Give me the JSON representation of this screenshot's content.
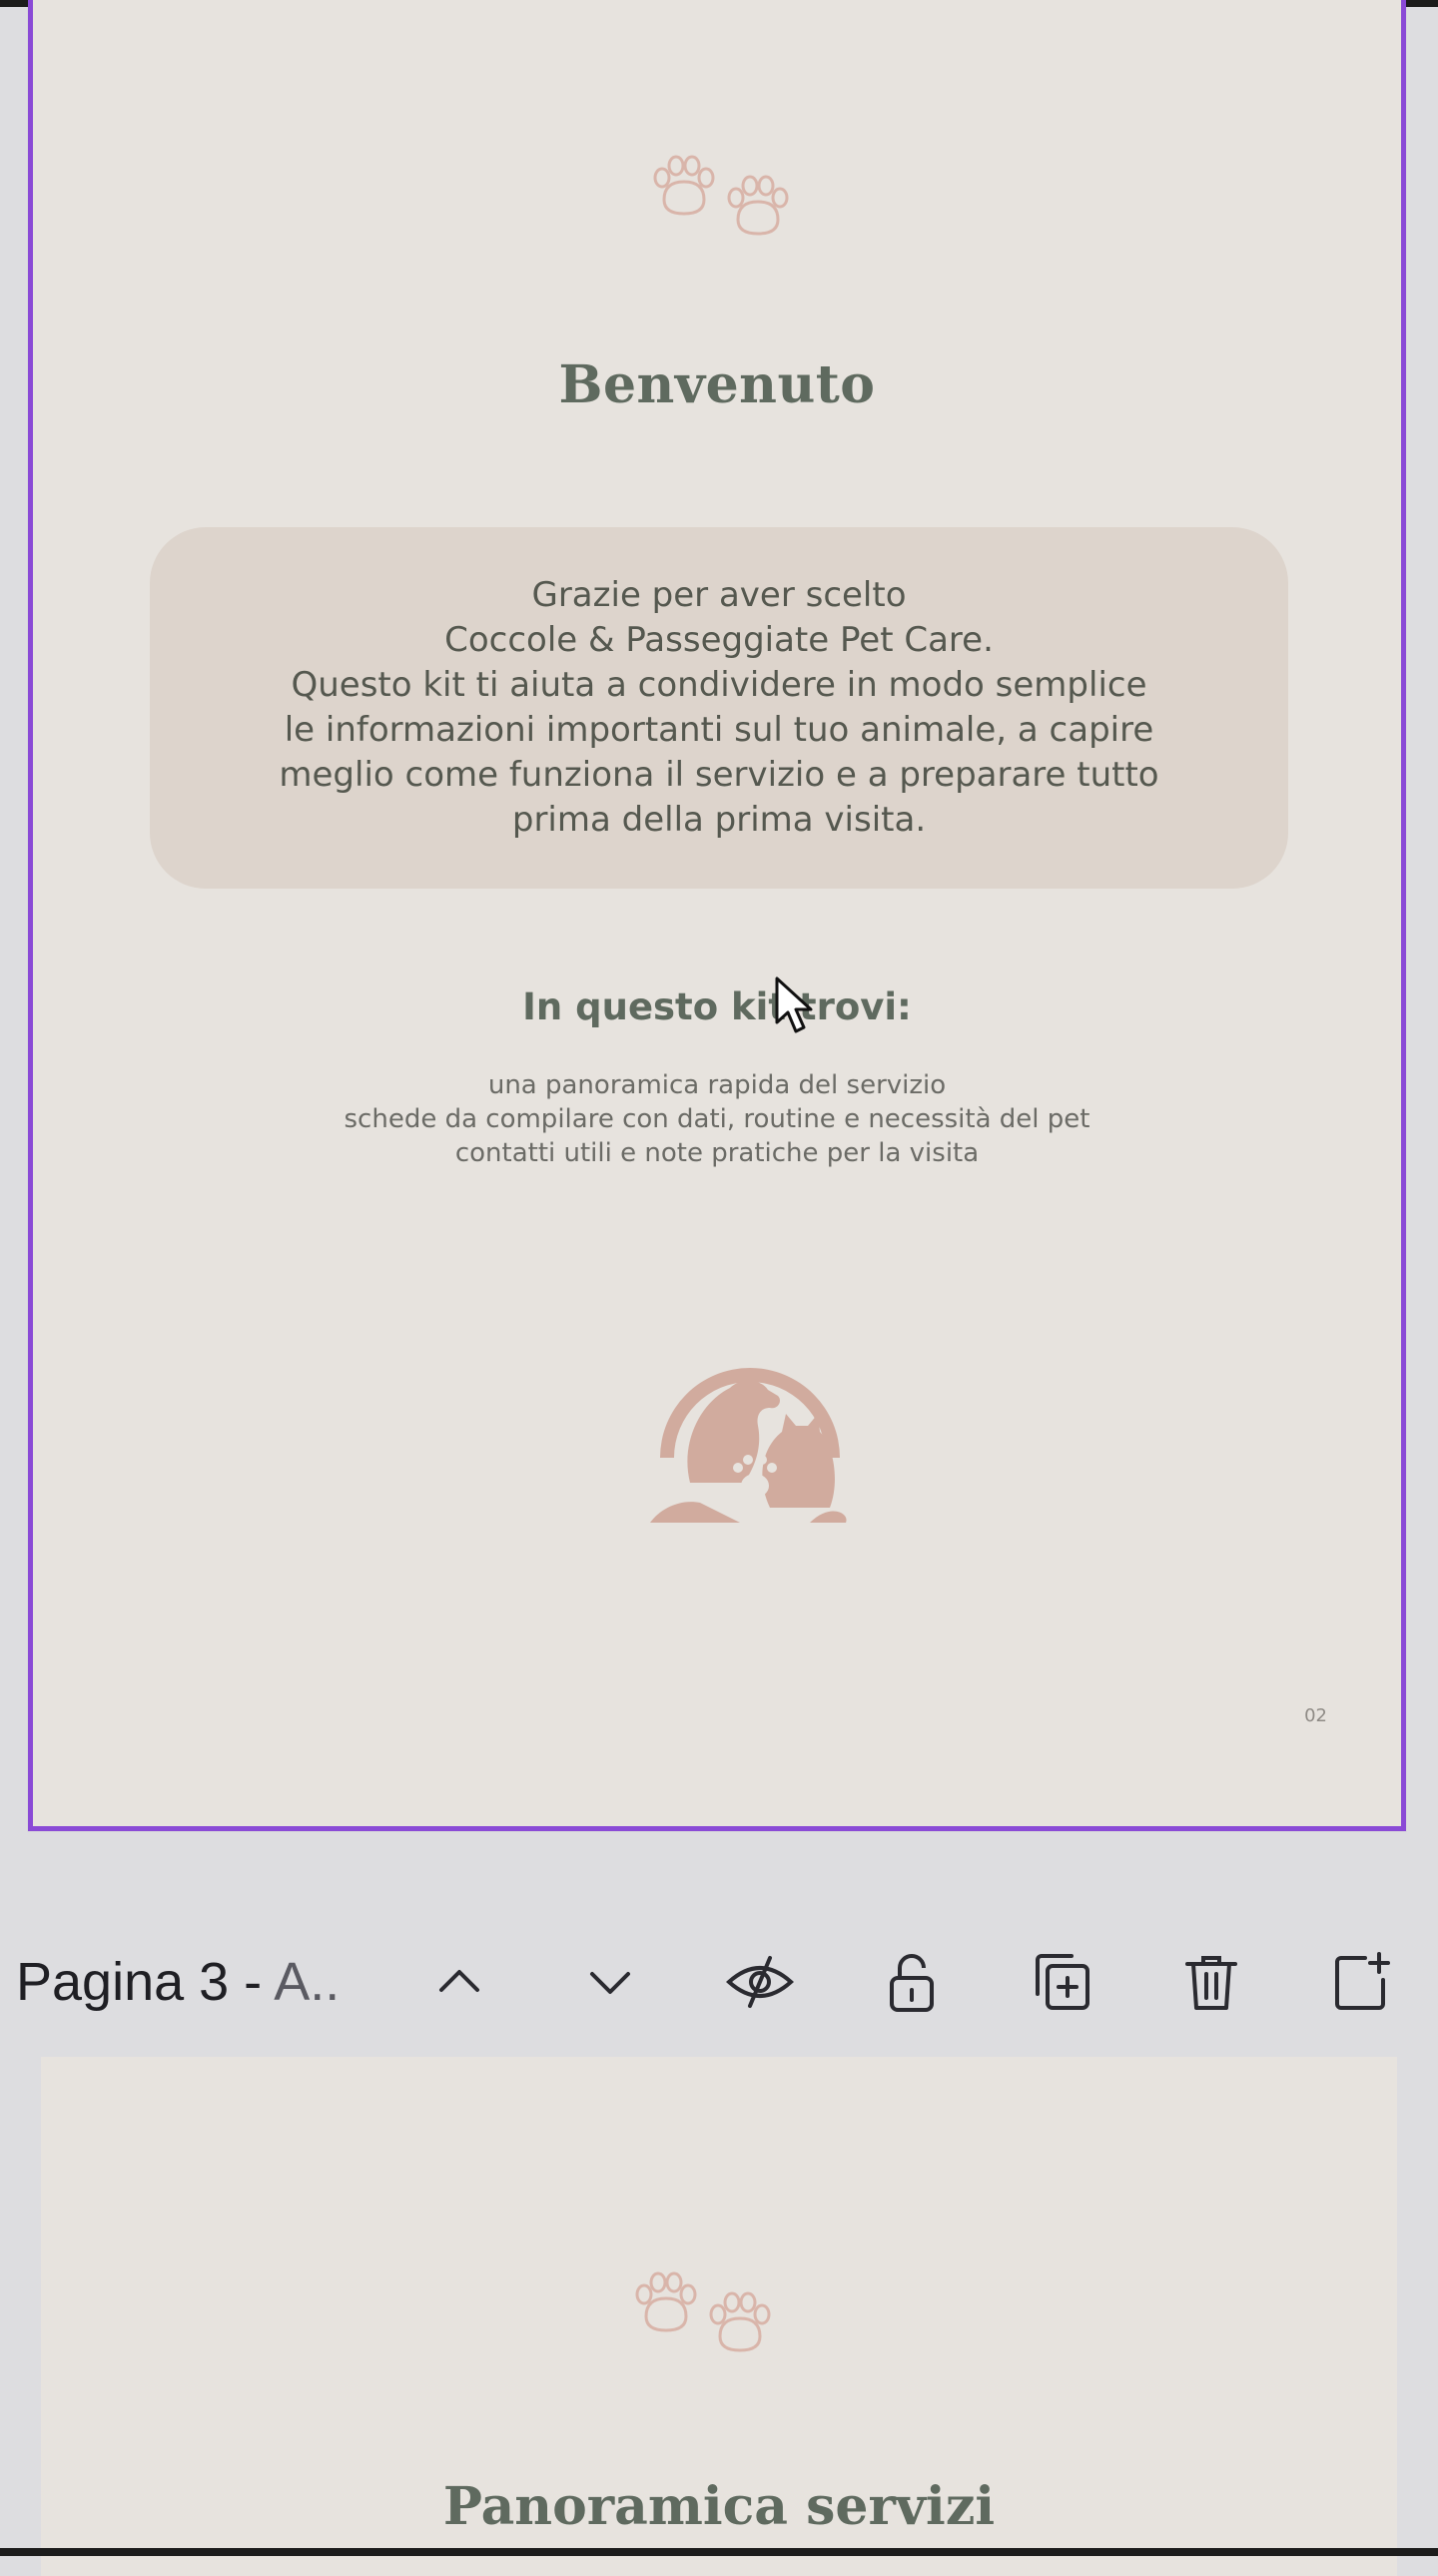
{
  "page2": {
    "welcome_title": "Benvenuto",
    "intro_lines": [
      "Grazie per aver scelto",
      "Coccole & Passeggiate Pet Care.",
      "Questo kit ti aiuta a condividere in modo semplice",
      "le informazioni importanti sul tuo animale, a capire",
      "meglio come funziona il servizio e a preparare tutto",
      "prima della prima visita."
    ],
    "kit_heading": "In questo kit trovi:",
    "kit_items": [
      "una panoramica rapida del servizio",
      "schede da compilare con dati, routine e necessità del pet",
      "contatti utili e note pratiche per la visita"
    ],
    "page_number": "02"
  },
  "toolbar": {
    "page_label_main": "Pagina 3 - ",
    "page_label_rest": "A.."
  },
  "page3": {
    "title": "Panoramica servizi"
  },
  "icons": {
    "move_up": "chevron-up-icon",
    "move_down": "chevron-down-icon",
    "hide": "eye-slash-icon",
    "lock": "unlock-icon",
    "duplicate": "duplicate-page-icon",
    "delete": "trash-icon",
    "add": "add-page-icon"
  },
  "colors": {
    "selection_border": "#8a4ad6",
    "page_background": "#e7e3de",
    "accent_pink": "#d1ab9e",
    "heading_green": "#5f6a5f",
    "intro_box": "#ddd4cc"
  }
}
